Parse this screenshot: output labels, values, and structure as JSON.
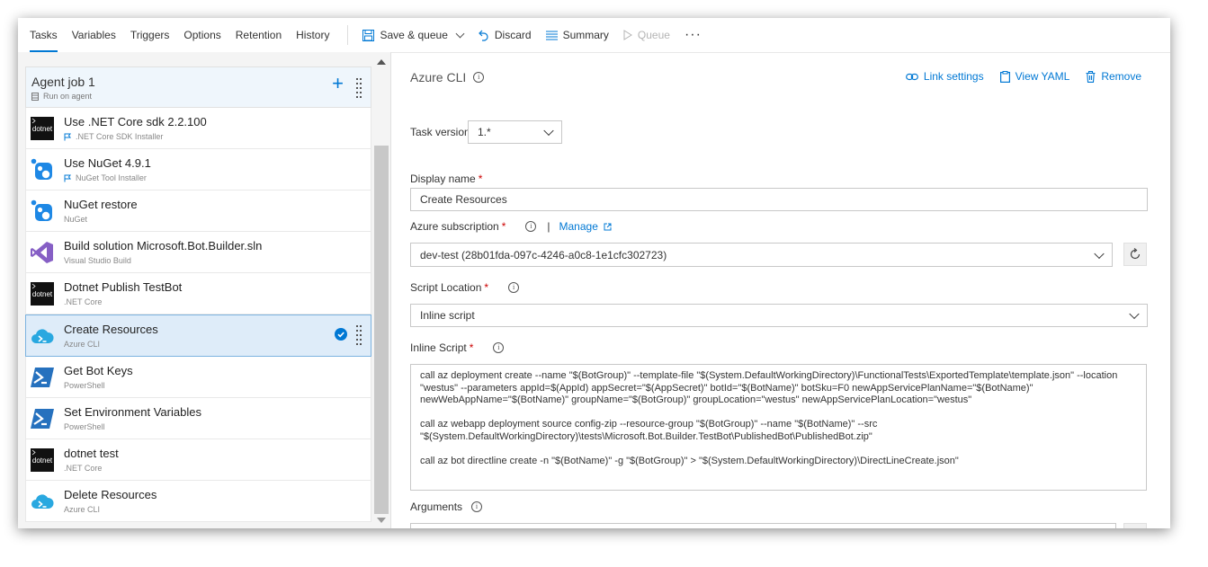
{
  "toolbar": {
    "tabs": [
      "Tasks",
      "Variables",
      "Triggers",
      "Options",
      "Retention",
      "History"
    ],
    "save_queue_label": "Save & queue",
    "discard_label": "Discard",
    "summary_label": "Summary",
    "queue_label": "Queue",
    "more_label": "···"
  },
  "job": {
    "title": "Agent job 1",
    "subtitle": "Run on agent"
  },
  "tasks": [
    {
      "name": "Use .NET Core sdk 2.2.100",
      "sub": ".NET Core SDK Installer",
      "icon": "dotnet-icon",
      "flag": true
    },
    {
      "name": "Use NuGet 4.9.1",
      "sub": "NuGet Tool Installer",
      "icon": "nuget-icon",
      "flag": true
    },
    {
      "name": "NuGet restore",
      "sub": "NuGet",
      "icon": "nuget-icon",
      "flag": false
    },
    {
      "name": "Build solution Microsoft.Bot.Builder.sln",
      "sub": "Visual Studio Build",
      "icon": "visual-studio-icon",
      "flag": false
    },
    {
      "name": "Dotnet Publish TestBot",
      "sub": ".NET Core",
      "icon": "dotnet-icon",
      "flag": false
    },
    {
      "name": "Create Resources",
      "sub": "Azure CLI",
      "icon": "azure-cli-icon",
      "flag": false,
      "selected": true
    },
    {
      "name": "Get Bot Keys",
      "sub": "PowerShell",
      "icon": "powershell-icon",
      "flag": false
    },
    {
      "name": "Set Environment Variables",
      "sub": "PowerShell",
      "icon": "powershell-icon",
      "flag": false
    },
    {
      "name": "dotnet test",
      "sub": ".NET Core",
      "icon": "dotnet-icon",
      "flag": false
    },
    {
      "name": "Delete Resources",
      "sub": "Azure CLI",
      "icon": "azure-cli-icon",
      "flag": false
    }
  ],
  "icon_text": {
    "dotnet": "dotnet"
  },
  "detail": {
    "title": "Azure CLI",
    "link_settings": "Link settings",
    "view_yaml": "View YAML",
    "remove": "Remove",
    "task_version_label": "Task version",
    "task_version_value": "1.*",
    "display_name_label": "Display name",
    "display_name_value": "Create Resources",
    "subscription_label": "Azure subscription",
    "manage_label": "Manage",
    "subscription_value": "dev-test (28b01fda-097c-4246-a0c8-1e1cfc302723)",
    "script_location_label": "Script Location",
    "script_location_value": "Inline script",
    "inline_script_label": "Inline Script",
    "inline_script_value": "call az deployment create --name \"$(BotGroup)\" --template-file \"$(System.DefaultWorkingDirectory)\\FunctionalTests\\ExportedTemplate\\template.json\" --location \"westus\" --parameters appId=$(AppId) appSecret=\"$(AppSecret)\" botId=\"$(BotName)\" botSku=F0 newAppServicePlanName=\"$(BotName)\" newWebAppName=\"$(BotName)\" groupName=\"$(BotGroup)\" groupLocation=\"westus\" newAppServicePlanLocation=\"westus\"\n\ncall az webapp deployment source config-zip --resource-group \"$(BotGroup)\" --name \"$(BotName)\" --src \"$(System.DefaultWorkingDirectory)\\tests\\Microsoft.Bot.Builder.TestBot\\PublishedBot\\PublishedBot.zip\"\n\ncall az bot directline create -n \"$(BotName)\" -g \"$(BotGroup)\" > \"$(System.DefaultWorkingDirectory)\\DirectLineCreate.json\"",
    "arguments_label": "Arguments",
    "arguments_value": "",
    "required_mark": "*",
    "info_mark": "i",
    "separator": "|"
  },
  "colors": {
    "accent": "#0078d4",
    "selected_bg": "#deecf9",
    "job_bg": "#eff6fc"
  }
}
